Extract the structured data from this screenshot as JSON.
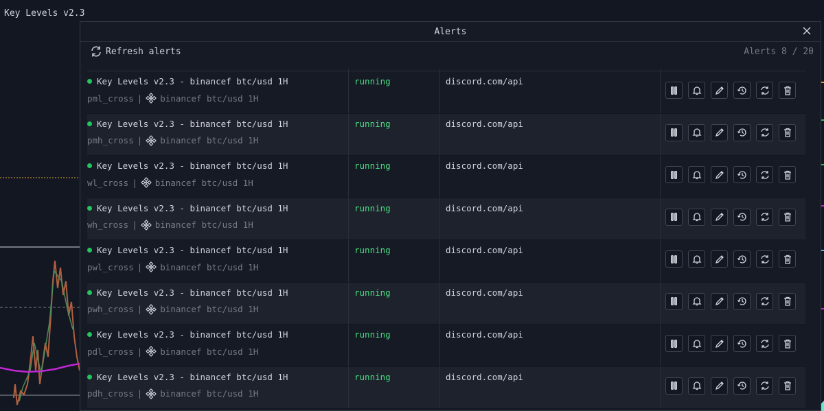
{
  "indicator": {
    "title": "Key Levels v2.3"
  },
  "panel": {
    "title": "Alerts",
    "refresh_label": "Refresh alerts",
    "count_label": "Alerts 8 / 20"
  },
  "colors": {
    "running": "#4ade80",
    "status_dot": "#22c55e",
    "accent_magenta": "#c026d3"
  },
  "icons": {
    "actions": [
      "pause-icon",
      "bell-icon",
      "pencil-icon",
      "history-icon",
      "restart-icon",
      "trash-icon"
    ]
  },
  "alerts": [
    {
      "name": "Key Levels v2.3 - binancef btc/usd 1H",
      "condition": "pml_cross",
      "symbol": "binancef btc/usd 1H",
      "status": "running",
      "webhook": "discord.com/api"
    },
    {
      "name": "Key Levels v2.3 - binancef btc/usd 1H",
      "condition": "pmh_cross",
      "symbol": "binancef btc/usd 1H",
      "status": "running",
      "webhook": "discord.com/api"
    },
    {
      "name": "Key Levels v2.3 - binancef btc/usd 1H",
      "condition": "wl_cross",
      "symbol": "binancef btc/usd 1H",
      "status": "running",
      "webhook": "discord.com/api"
    },
    {
      "name": "Key Levels v2.3 - binancef btc/usd 1H",
      "condition": "wh_cross",
      "symbol": "binancef btc/usd 1H",
      "status": "running",
      "webhook": "discord.com/api"
    },
    {
      "name": "Key Levels v2.3 - binancef btc/usd 1H",
      "condition": "pwl_cross",
      "symbol": "binancef btc/usd 1H",
      "status": "running",
      "webhook": "discord.com/api"
    },
    {
      "name": "Key Levels v2.3 - binancef btc/usd 1H",
      "condition": "pwh_cross",
      "symbol": "binancef btc/usd 1H",
      "status": "running",
      "webhook": "discord.com/api"
    },
    {
      "name": "Key Levels v2.3 - binancef btc/usd 1H",
      "condition": "pdl_cross",
      "symbol": "binancef btc/usd 1H",
      "status": "running",
      "webhook": "discord.com/api"
    },
    {
      "name": "Key Levels v2.3 - binancef btc/usd 1H",
      "condition": "pdh_cross",
      "symbol": "binancef btc/usd 1H",
      "status": "running",
      "webhook": "discord.com/api"
    }
  ]
}
